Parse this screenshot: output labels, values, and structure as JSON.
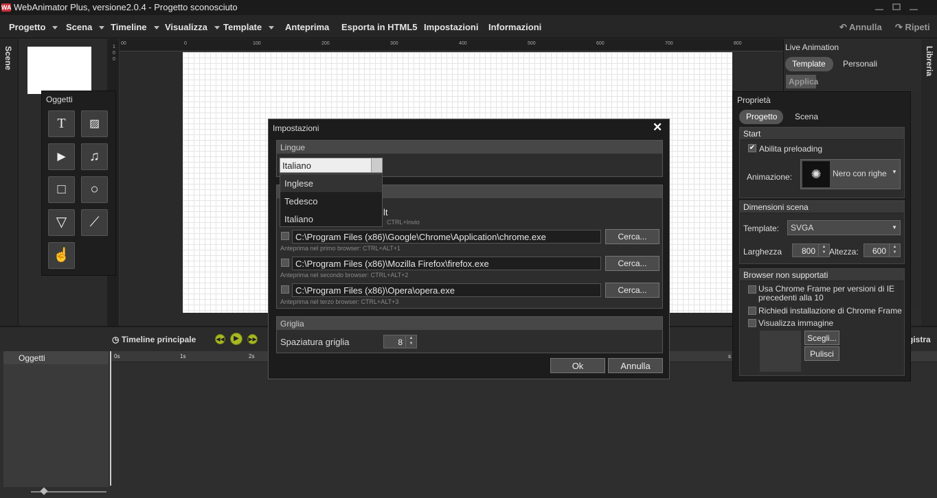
{
  "window": {
    "title": "WebAnimator Plus, versione2.0.4 - Progetto sconosciuto",
    "logo": "WA"
  },
  "menu": {
    "items": [
      "Progetto",
      "Scena",
      "Timeline",
      "Visualizza",
      "Template",
      "Anteprima",
      "Esporta in HTML5",
      "Impostazioni",
      "Informazioni"
    ],
    "undo": "Annulla",
    "redo": "Ripeti"
  },
  "sidebar_left": {
    "label": "Scene"
  },
  "sidebar_right": {
    "label": "Libreria"
  },
  "ruler": {
    "top_ticks": [
      "00",
      "0",
      "100",
      "200",
      "300",
      "400",
      "500",
      "600",
      "700",
      "800"
    ],
    "left_ticks": [
      "1",
      "0",
      "0"
    ]
  },
  "objects_panel": {
    "title": "Oggetti",
    "tools": [
      "text-tool",
      "image-tool",
      "video-tool",
      "audio-tool",
      "rectangle-tool",
      "ellipse-tool",
      "triangle-tool",
      "line-tool",
      "hand-tool"
    ]
  },
  "timeline": {
    "title": "Timeline principale",
    "objects_header": "Oggetti",
    "ticks": [
      "0s",
      "1s",
      "2s",
      "s"
    ],
    "record_partial": "gistra"
  },
  "live_animation": {
    "title": "Live Animation",
    "tabs": [
      "Template",
      "Personali"
    ],
    "apply": "Applica"
  },
  "properties": {
    "title": "Proprietà",
    "tabs": [
      "Progetto",
      "Scena"
    ],
    "start": {
      "header": "Start",
      "preloading_label": "Abilita preloading",
      "preloading_checked": true,
      "animation_label": "Animazione:",
      "animation_value": "Nero con righe b"
    },
    "dimensions": {
      "header": "Dimensioni scena",
      "template_label": "Template:",
      "template_value": "SVGA",
      "width_label": "Larghezza",
      "width_value": "800",
      "height_label": "Altezza:",
      "height_value": "600"
    },
    "unsupported": {
      "header": "Browser non supportati",
      "opt1": "Usa Chrome Frame per versioni di IE precedenti alla 10",
      "opt2": "Richiedi installazione di Chrome Frame",
      "opt3": "Visualizza immagine",
      "choose": "Scegli...",
      "clear": "Pulisci"
    }
  },
  "dialog": {
    "title": "Impostazioni",
    "lang_section": "Lingue",
    "lang_selected": "Italiano",
    "lang_options": [
      "Inglese",
      "Tedesco",
      "Italiano"
    ],
    "preview_partial": "lt",
    "preview_shortcut": "CTRL+Invio",
    "browsers": [
      {
        "path": "C:\\Program Files (x86)\\Google\\Chrome\\Application\\chrome.exe",
        "hint": "Anteprima nel primo browser: CTRL+ALT+1"
      },
      {
        "path": "C:\\Program Files (x86)\\Mozilla Firefox\\firefox.exe",
        "hint": "Anteprima nel secondo browser: CTRL+ALT+2"
      },
      {
        "path": "C:\\Program Files (x86)\\Opera\\opera.exe",
        "hint": "Anteprima nel terzo browser: CTRL+ALT+3"
      }
    ],
    "browse": "Cerca...",
    "grid_section": "Griglia",
    "grid_label": "Spaziatura griglia",
    "grid_value": "8",
    "ok": "Ok",
    "cancel": "Annulla"
  },
  "colors": {
    "accent_play": "#a8b822",
    "logo": "#c8303a"
  }
}
